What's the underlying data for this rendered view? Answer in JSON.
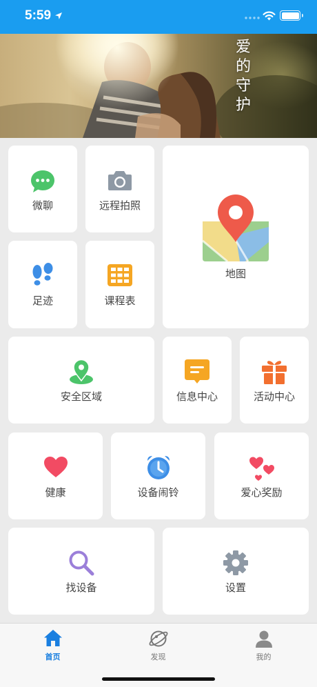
{
  "status_bar": {
    "time": "5:59"
  },
  "banner": {
    "caption": "爱的守护"
  },
  "tiles": {
    "chat": "微聊",
    "remote_photo": "远程拍照",
    "map": "地图",
    "footprints": "足迹",
    "schedule": "课程表",
    "safe_zone": "安全区域",
    "messages": "信息中心",
    "activities": "活动中心",
    "health": "健康",
    "alarm": "设备闹铃",
    "love_reward": "爱心奖励",
    "find_device": "找设备",
    "settings": "设置"
  },
  "tabbar": {
    "home": "首页",
    "discover": "发现",
    "mine": "我的"
  },
  "colors": {
    "accent": "#1a9df0",
    "tab_active": "#1a7fe0",
    "chat_green": "#4cc46a",
    "map_pin": "#ee5a4a",
    "orange": "#f5a623",
    "gift_orange": "#f26f2f",
    "heart": "#f24b63",
    "alarm_blue": "#3d8ee6",
    "search_purple": "#9b7fd9",
    "gear_gray": "#8e99a5"
  }
}
